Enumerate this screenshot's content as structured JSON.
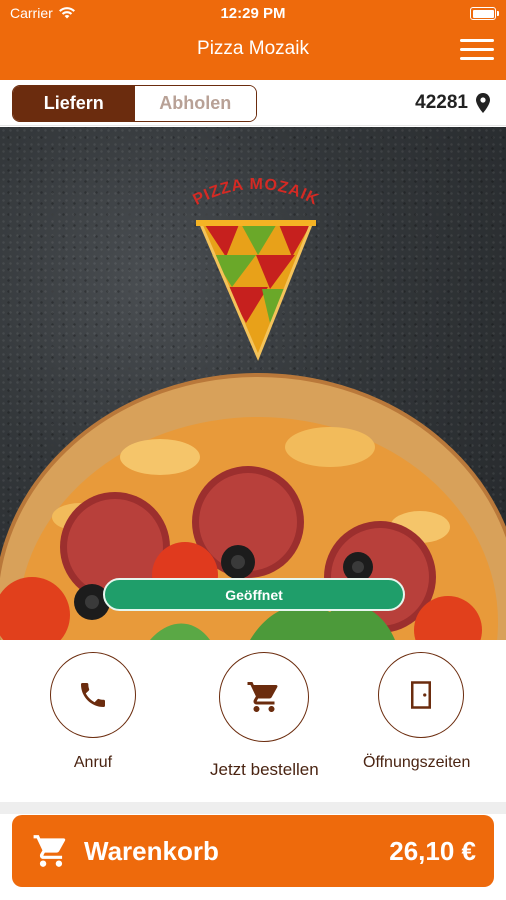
{
  "status_bar": {
    "carrier": "Carrier",
    "time": "12:29 PM"
  },
  "nav": {
    "title": "Pizza Mozaik",
    "menu_icon": "hamburger-menu-icon"
  },
  "delivery": {
    "options": [
      "Liefern",
      "Abholen"
    ],
    "selected": "Liefern",
    "zip": "42281",
    "zip_icon": "location-pin-icon"
  },
  "hero": {
    "logo_text": "PIZZA MOZAIK",
    "status_button": "Geöffnet"
  },
  "actions": [
    {
      "label": "Anruf",
      "icon": "phone-icon"
    },
    {
      "label": "Jetzt bestellen",
      "icon": "cart-icon"
    },
    {
      "label": "Öffnungszeiten",
      "icon": "door-icon"
    }
  ],
  "cart": {
    "label": "Warenkorb",
    "total": "26,10 €",
    "icon": "cart-icon"
  },
  "colors": {
    "brand_orange": "#ee6a0c",
    "brand_brown": "#6b2c0e",
    "open_green": "#1f9e6a"
  }
}
